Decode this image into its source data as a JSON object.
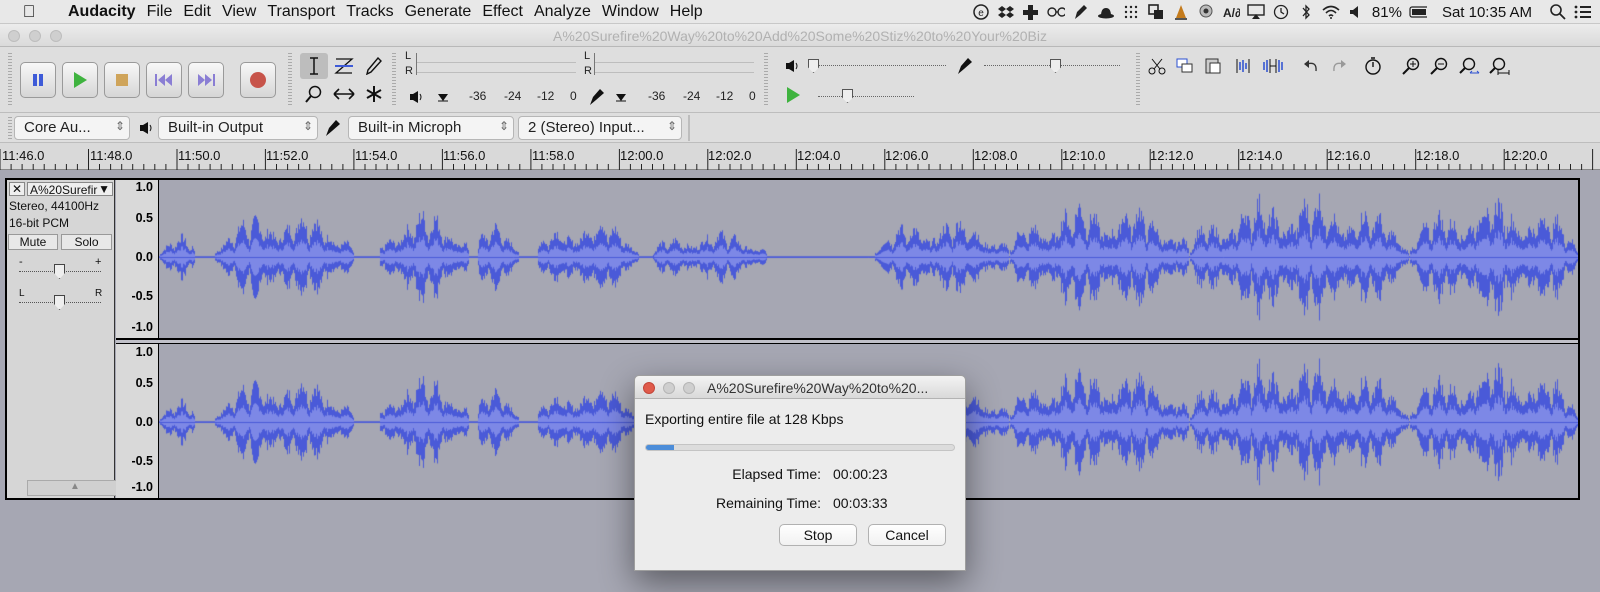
{
  "menubar": {
    "items": [
      "Audacity",
      "File",
      "Edit",
      "View",
      "Transport",
      "Tracks",
      "Generate",
      "Effect",
      "Analyze",
      "Window",
      "Help"
    ],
    "battery": "81%",
    "clock": "Sat 10:35 AM"
  },
  "window": {
    "title": "A%20Surefire%20Way%20to%20Add%20Some%20Stiz%20to%20Your%20Biz"
  },
  "meters": {
    "record_l": "L",
    "record_r": "R",
    "play_l": "L",
    "play_r": "R",
    "scale_labels": [
      "-36",
      "-24",
      "-12",
      "0"
    ]
  },
  "device": {
    "host": "Core Au...",
    "output": "Built-in Output",
    "input": "Built-in Microph",
    "channels": "2 (Stereo) Input..."
  },
  "ruler": {
    "labels": [
      "11:46.0",
      "11:48.0",
      "11:50.0",
      "11:52.0",
      "11:54.0",
      "11:56.0",
      "11:58.0",
      "12:00.0",
      "12:02.0",
      "12:04.0",
      "12:06.0",
      "12:08.0",
      "12:10.0",
      "12:12.0",
      "12:14.0",
      "12:16.0",
      "12:18.0",
      "12:20.0"
    ]
  },
  "track": {
    "name": "A%20Surefir",
    "info_rate": "Stereo, 44100Hz",
    "info_format": "16-bit PCM",
    "mute_label": "Mute",
    "solo_label": "Solo",
    "gain_minus": "-",
    "gain_plus": "+",
    "pan_left": "L",
    "pan_right": "R",
    "y_labels": [
      "1.0",
      "0.5",
      "0.0",
      "-0.5",
      "-1.0"
    ],
    "waveform_color": "#4a5ad8",
    "waveform_rms_color": "#7d88e6"
  },
  "dialog": {
    "title": "A%20Surefire%20Way%20to%20...",
    "message": "Exporting entire file at 128 Kbps",
    "progress": 0.09,
    "elapsed_label": "Elapsed Time:",
    "elapsed_value": "00:00:23",
    "remaining_label": "Remaining Time:",
    "remaining_value": "00:03:33",
    "stop_label": "Stop",
    "cancel_label": "Cancel"
  }
}
